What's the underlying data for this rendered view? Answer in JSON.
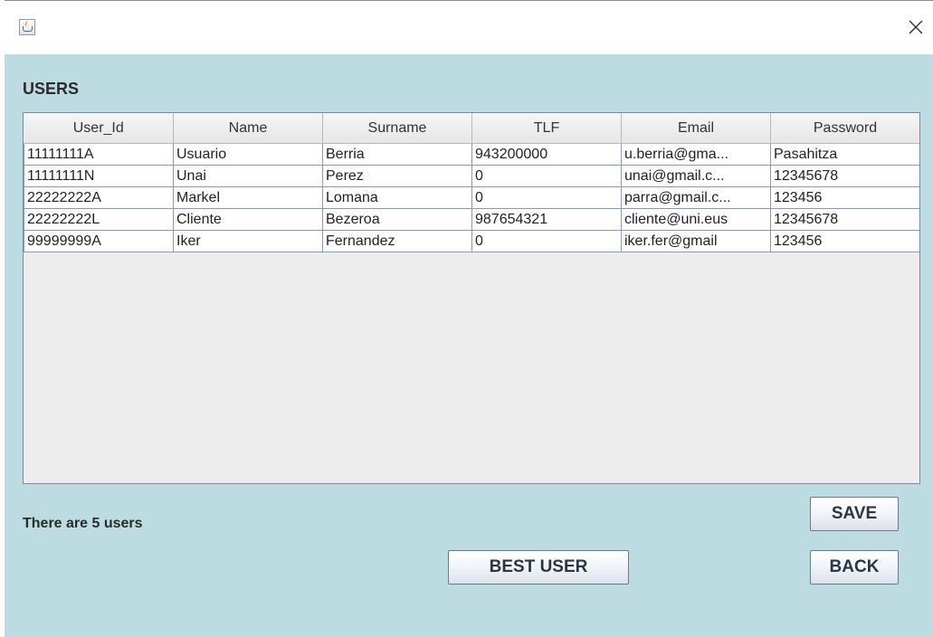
{
  "window": {
    "close_icon": "close-icon",
    "app_icon": "java-cup-icon"
  },
  "panel": {
    "title": "USERS",
    "status_text": "There are 5 users"
  },
  "table": {
    "columns": [
      "User_Id",
      "Name",
      "Surname",
      "TLF",
      "Email",
      "Password"
    ],
    "rows": [
      [
        "11111111A",
        "Usuario",
        "Berria",
        "943200000",
        "u.berria@gma...",
        "Pasahitza"
      ],
      [
        "11111111N",
        "Unai",
        "Perez",
        "0",
        "unai@gmail.c...",
        "12345678"
      ],
      [
        "22222222A",
        "Markel",
        "Lomana",
        "0",
        "parra@gmail.c...",
        "123456"
      ],
      [
        "22222222L",
        "Cliente",
        "Bezeroa",
        "987654321",
        "cliente@uni.eus",
        "12345678"
      ],
      [
        "99999999A",
        "Iker",
        "Fernandez",
        "0",
        "iker.fer@gmail",
        "123456"
      ]
    ]
  },
  "buttons": {
    "save_label": "SAVE",
    "back_label": "BACK",
    "best_user_label": "BEST USER"
  },
  "colors": {
    "panel_background": "#bcdce2",
    "table_empty_area": "#ededed"
  }
}
